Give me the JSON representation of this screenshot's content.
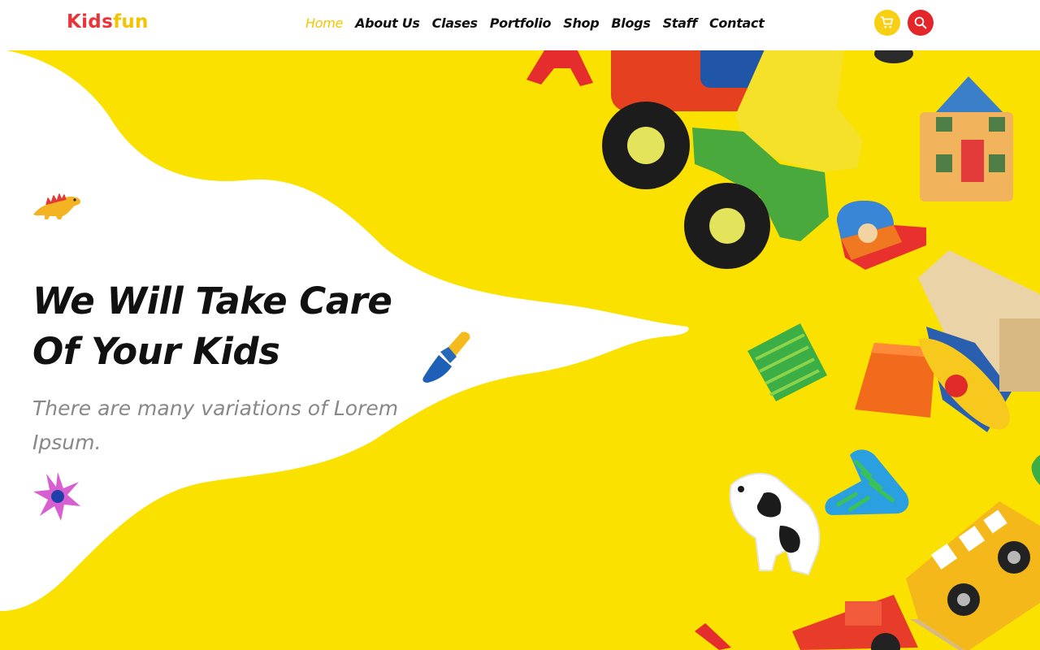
{
  "brand": {
    "part1": "Kids",
    "part2": "fun"
  },
  "nav": {
    "items": [
      {
        "label": "Home",
        "active": true
      },
      {
        "label": "About Us"
      },
      {
        "label": "Clases"
      },
      {
        "label": "Portfolio"
      },
      {
        "label": "Shop"
      },
      {
        "label": "Blogs"
      },
      {
        "label": "Staff"
      },
      {
        "label": "Contact"
      }
    ]
  },
  "header_icons": {
    "cart": "cart-icon",
    "search": "search-icon"
  },
  "hero": {
    "title_line1": "We Will Take Care",
    "title_line2": "Of Your Kids",
    "subtitle": "There are many variations of Lorem Ipsum."
  },
  "decorations": [
    "dinosaur-icon",
    "paintbrush-icon",
    "flower-icon"
  ],
  "colors": {
    "yellow": "#fbe100",
    "brand_red": "#e8343a",
    "brand_yellow": "#f5c400",
    "search_red": "#e4262a",
    "cart_yellow": "#f8cf12"
  }
}
